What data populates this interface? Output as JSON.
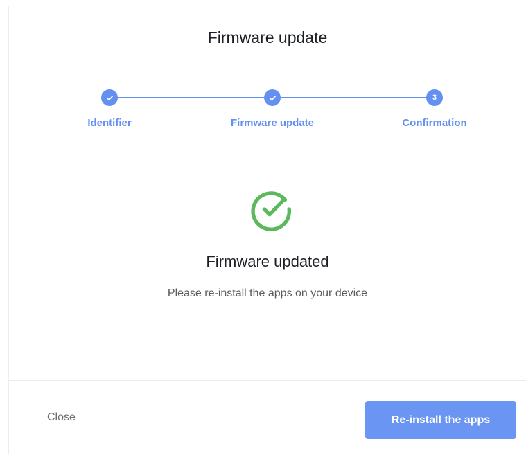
{
  "modal": {
    "title": "Firmware update"
  },
  "stepper": {
    "steps": [
      {
        "label": "Identifier",
        "state": "done",
        "icon": "check-icon"
      },
      {
        "label": "Firmware update",
        "state": "done",
        "icon": "check-icon"
      },
      {
        "label": "Confirmation",
        "state": "active",
        "number": "3"
      }
    ],
    "accent_color": "#6490f1"
  },
  "result": {
    "icon": "success-check-circle-icon",
    "icon_color": "#5cb85c",
    "heading": "Firmware updated",
    "message": "Please re-install the apps on your device"
  },
  "footer": {
    "close_label": "Close",
    "primary_label": "Re-install the apps",
    "primary_color": "#6b95f2"
  }
}
